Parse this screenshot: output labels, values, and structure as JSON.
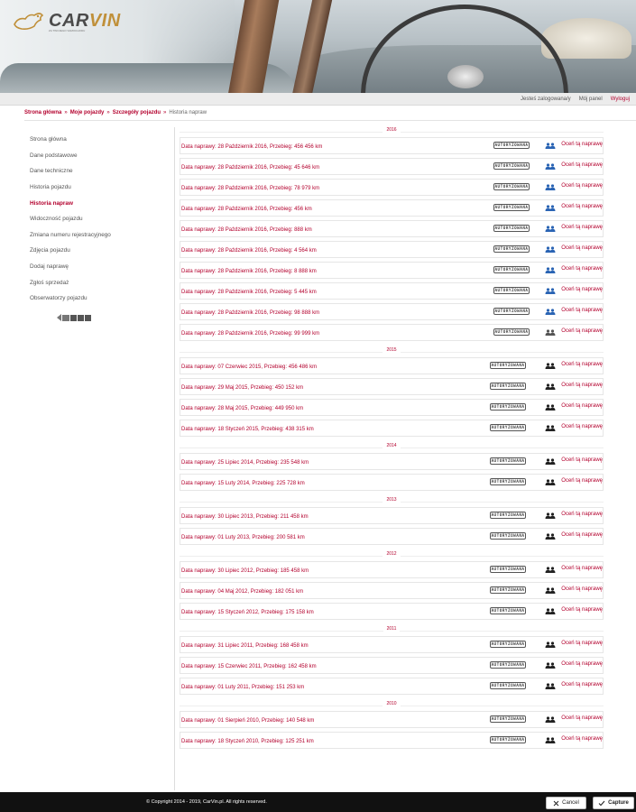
{
  "brand": {
    "name_part1": "CAR",
    "name_part2": "VIN",
    "tagline": "ZA TWOJEGO SAMOCHODU"
  },
  "userbar": {
    "logged_in": "Jesteś zalogowana/y",
    "panel": "Mój panel",
    "logout": "Wyloguj"
  },
  "breadcrumb": {
    "home": "Strona główna",
    "my_vehicles": "Moje pojazdy",
    "vehicle_details": "Szczegóły pojazdu",
    "current": "Historia napraw",
    "sep": "»"
  },
  "sidebar": {
    "items": [
      {
        "label": "Strona główna"
      },
      {
        "label": "Dane podstawowe"
      },
      {
        "label": "Dane techniczne"
      },
      {
        "label": "Historia pojazdu"
      },
      {
        "label": "Historia napraw",
        "active": true
      },
      {
        "label": "Widoczność pojazdu"
      },
      {
        "label": "Zmiana numeru rejestracyjnego"
      },
      {
        "label": "Zdjęcia pojazdu"
      },
      {
        "label": "Dodaj naprawę"
      },
      {
        "label": "Zgłoś sprzedaż"
      },
      {
        "label": "Obserwatorzy pojazdu"
      }
    ]
  },
  "stamp_label": "AUTORYZOWANA",
  "rate_label": "Oceń tą naprawę",
  "groups": [
    {
      "year": "2016",
      "rows": [
        {
          "text": "Data naprawy: 28 Październik 2016, Przebieg: 456 456 km",
          "people_color": "#2a64b4"
        },
        {
          "text": "Data naprawy: 28 Październik 2016, Przebieg: 45 646 km",
          "people_color": "#2a64b4"
        },
        {
          "text": "Data naprawy: 28 Październik 2016, Przebieg: 78 979 km",
          "people_color": "#2a64b4"
        },
        {
          "text": "Data naprawy: 28 Październik 2016, Przebieg: 456 km",
          "people_color": "#2a64b4"
        },
        {
          "text": "Data naprawy: 28 Październik 2016, Przebieg: 888 km",
          "people_color": "#2a64b4"
        },
        {
          "text": "Data naprawy: 28 Październik 2016, Przebieg: 4 564 km",
          "people_color": "#2a64b4"
        },
        {
          "text": "Data naprawy: 28 Październik 2016, Przebieg: 8 888 km",
          "people_color": "#2a64b4"
        },
        {
          "text": "Data naprawy: 28 Październik 2016, Przebieg: 5 445 km",
          "people_color": "#2a64b4"
        },
        {
          "text": "Data naprawy: 28 Październik 2016, Przebieg: 98 888 km",
          "people_color": "#2a64b4"
        },
        {
          "text": "Data naprawy: 28 Październik 2016, Przebieg: 99 999 km",
          "people_color": "#555555"
        }
      ]
    },
    {
      "year": "2015",
      "rows": [
        {
          "text": "Data naprawy: 07 Czerwiec 2015, Przebieg: 456 486 km",
          "people_color": "#222222"
        },
        {
          "text": "Data naprawy: 29 Maj 2015, Przebieg: 450 152 km",
          "people_color": "#222222"
        },
        {
          "text": "Data naprawy: 28 Maj 2015, Przebieg: 449 950 km",
          "people_color": "#222222"
        },
        {
          "text": "Data naprawy: 18 Styczeń 2015, Przebieg: 438 315 km",
          "people_color": "#222222"
        }
      ]
    },
    {
      "year": "2014",
      "rows": [
        {
          "text": "Data naprawy: 25 Lipiec 2014, Przebieg: 235 548 km",
          "people_color": "#222222"
        },
        {
          "text": "Data naprawy: 15 Luty 2014, Przebieg: 225 728 km",
          "people_color": "#222222"
        }
      ]
    },
    {
      "year": "2013",
      "rows": [
        {
          "text": "Data naprawy: 30 Lipiec 2013, Przebieg: 211 458 km",
          "people_color": "#222222"
        },
        {
          "text": "Data naprawy: 01 Luty 2013, Przebieg: 200 581 km",
          "people_color": "#222222"
        }
      ]
    },
    {
      "year": "2012",
      "rows": [
        {
          "text": "Data naprawy: 30 Lipiec 2012, Przebieg: 185 458 km",
          "people_color": "#222222"
        },
        {
          "text": "Data naprawy: 04 Maj 2012, Przebieg: 182 051 km",
          "people_color": "#222222"
        },
        {
          "text": "Data naprawy: 15 Styczeń 2012, Przebieg: 175 158 km",
          "people_color": "#222222"
        }
      ]
    },
    {
      "year": "2011",
      "rows": [
        {
          "text": "Data naprawy: 31 Lipiec 2011, Przebieg: 168 458 km",
          "people_color": "#222222"
        },
        {
          "text": "Data naprawy: 15 Czerwiec 2011, Przebieg: 162 458 km",
          "people_color": "#222222"
        },
        {
          "text": "Data naprawy: 01 Luty 2011, Przebieg: 151 253 km",
          "people_color": "#222222"
        }
      ]
    },
    {
      "year": "2010",
      "rows": [
        {
          "text": "Data naprawy: 01 Sierpień 2010, Przebieg: 140 548 km",
          "people_color": "#222222"
        },
        {
          "text": "Data naprawy: 18 Styczeń 2010, Przebieg: 125 251 km",
          "people_color": "#222222"
        }
      ]
    }
  ],
  "footer": {
    "copyright": "© Copyright 2014 - 2019, CarVin.pl. All rights reserved."
  },
  "capture_bar": {
    "cancel": "Cancel",
    "capture": "Capture"
  },
  "colors": {
    "accent": "#b3002d",
    "footer_bg": "#111111"
  }
}
